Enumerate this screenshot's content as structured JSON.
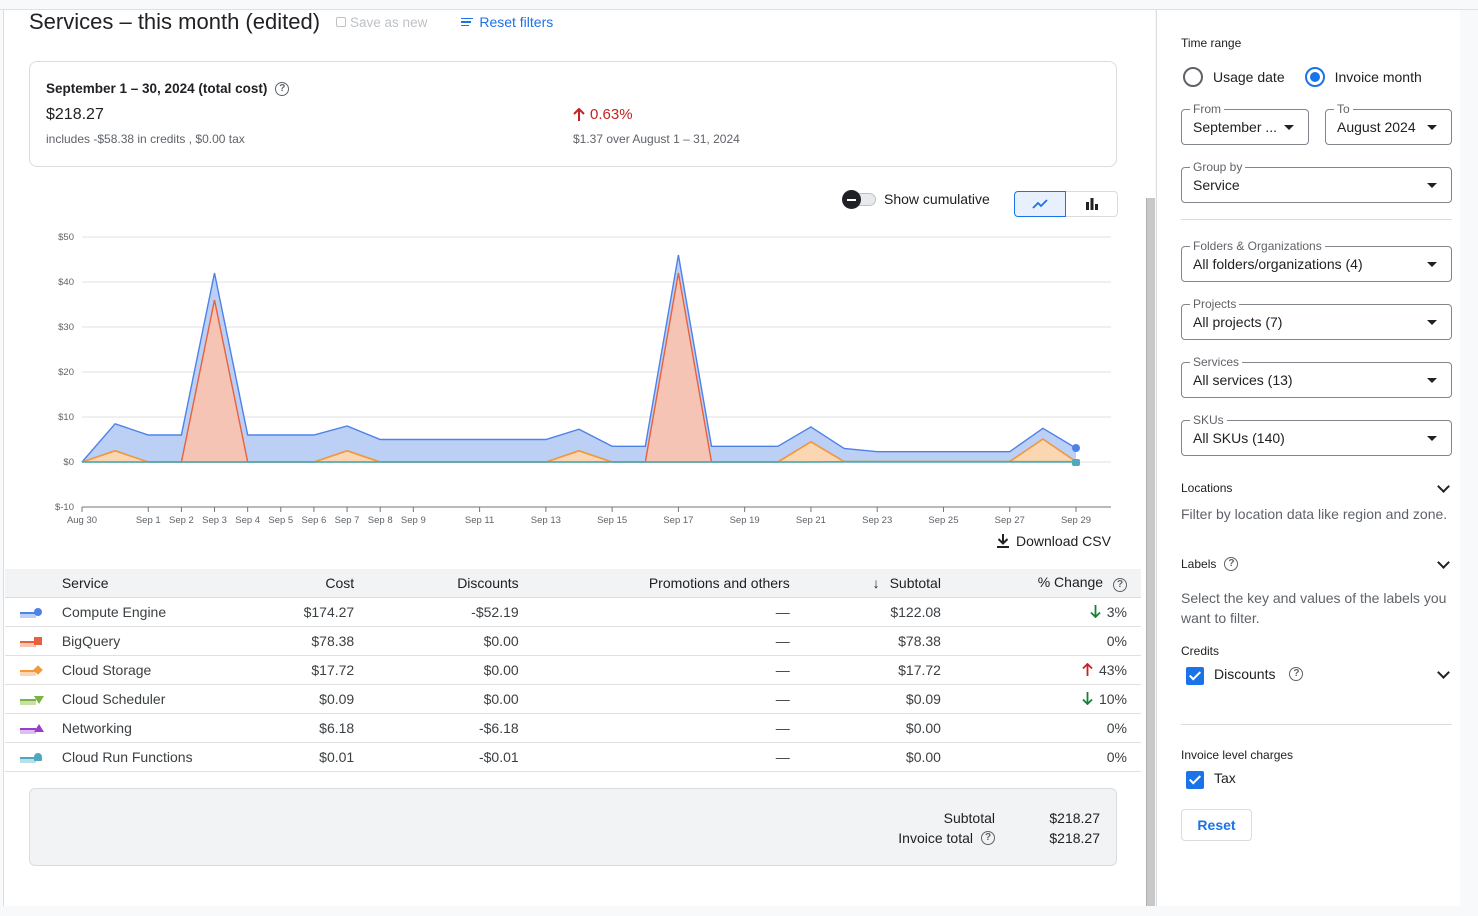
{
  "header": {
    "title": "Services – this month (edited)",
    "save_as_new": "Save as new",
    "reset_filters": "Reset filters"
  },
  "summary": {
    "title": "September 1 – 30, 2024 (total cost)",
    "total": "$218.27",
    "subtext": "includes -$58.38 in credits , $0.00 tax",
    "change": "0.63%",
    "change_direction": "up",
    "change_subtext": "$1.37 over August 1 – 31, 2024"
  },
  "chart_controls": {
    "show_cumulative_label": "Show cumulative",
    "show_cumulative_on": false,
    "selected_chart_type": "line"
  },
  "chart_data": {
    "type": "area",
    "stacked": true,
    "x": [
      "Aug 30",
      "Aug 31",
      "Sep 1",
      "Sep 2",
      "Sep 3",
      "Sep 4",
      "Sep 5",
      "Sep 6",
      "Sep 7",
      "Sep 8",
      "Sep 9",
      "Sep 10",
      "Sep 11",
      "Sep 12",
      "Sep 13",
      "Sep 14",
      "Sep 15",
      "Sep 16",
      "Sep 17",
      "Sep 18",
      "Sep 19",
      "Sep 20",
      "Sep 21",
      "Sep 22",
      "Sep 23",
      "Sep 24",
      "Sep 25",
      "Sep 26",
      "Sep 27",
      "Sep 28",
      "Sep 29"
    ],
    "x_tick_labels": [
      "Aug 30",
      "Sep 1",
      "Sep 2",
      "Sep 3",
      "Sep 4",
      "Sep 5",
      "Sep 6",
      "Sep 7",
      "Sep 8",
      "Sep 9",
      "Sep 11",
      "Sep 13",
      "Sep 15",
      "Sep 17",
      "Sep 19",
      "Sep 21",
      "Sep 23",
      "Sep 25",
      "Sep 27",
      "Sep 29"
    ],
    "y_tick_labels": [
      "$-10",
      "$0",
      "$10",
      "$20",
      "$30",
      "$40",
      "$50"
    ],
    "ylim": [
      -10,
      50
    ],
    "grid": true,
    "series": [
      {
        "name": "Cloud Run Functions",
        "color": "#4fa9be",
        "fill": "#b9e0e8",
        "values": [
          0,
          0,
          0,
          0,
          0,
          0,
          0,
          0,
          0,
          0,
          0,
          0,
          0,
          0,
          0,
          0,
          0,
          0,
          0,
          0,
          0,
          0,
          0,
          0,
          0,
          0,
          0,
          0,
          0,
          0,
          0
        ]
      },
      {
        "name": "Cloud Scheduler",
        "color": "#7cb342",
        "fill": "#c5e1a5",
        "values": [
          0,
          0,
          0,
          0,
          0,
          0,
          0,
          0,
          0,
          0,
          0,
          0,
          0,
          0,
          0,
          0,
          0,
          0,
          0,
          0,
          0,
          0,
          0,
          0.1,
          0.1,
          0.1,
          0.1,
          0.1,
          0.1,
          0.1,
          0.1
        ]
      },
      {
        "name": "Cloud Storage",
        "color": "#f29a38",
        "fill": "#fad6b2",
        "values": [
          0,
          2.5,
          0,
          0,
          0,
          0,
          0,
          0,
          2.5,
          0,
          0,
          0,
          0,
          0,
          0,
          2.5,
          0,
          0,
          0,
          0,
          0,
          0,
          4.5,
          0,
          0,
          0,
          0,
          0,
          0,
          5,
          0
        ]
      },
      {
        "name": "BigQuery",
        "color": "#e8613c",
        "fill": "#f6c4b4",
        "values": [
          0,
          0,
          0,
          0,
          36,
          0,
          0,
          0,
          0,
          0,
          0,
          0,
          0,
          0,
          0,
          0,
          0,
          0,
          42,
          0,
          0,
          0,
          0,
          0,
          0,
          0,
          0,
          0,
          0,
          0,
          0
        ]
      },
      {
        "name": "Compute Engine",
        "color": "#4e82e8",
        "fill": "#bcd0f6",
        "values": [
          0,
          6,
          6,
          6,
          6,
          6,
          6,
          6,
          5.5,
          5,
          5,
          5,
          5,
          5,
          5,
          4.8,
          3.5,
          3.5,
          4,
          3.5,
          3.5,
          3.5,
          3.3,
          2.9,
          2.2,
          2.2,
          2.2,
          2.2,
          2.2,
          2.4,
          3
        ]
      }
    ],
    "title": "",
    "xlabel": "",
    "ylabel": ""
  },
  "download_csv": "Download CSV",
  "table": {
    "columns": [
      "Service",
      "Cost",
      "Discounts",
      "Promotions and others",
      "Subtotal",
      "% Change"
    ],
    "sort_column": "Subtotal",
    "sort_direction": "desc",
    "rows": [
      {
        "service": "Compute Engine",
        "color": "#4e82e8",
        "fill": "#bcd0f6",
        "marker": "circle",
        "cost": "$174.27",
        "discounts": "-$52.19",
        "promotions": "—",
        "subtotal": "$122.08",
        "change": "3%",
        "change_dir": "down"
      },
      {
        "service": "BigQuery",
        "color": "#e8613c",
        "fill": "#f6c4b4",
        "marker": "square",
        "cost": "$78.38",
        "discounts": "$0.00",
        "promotions": "—",
        "subtotal": "$78.38",
        "change": "0%",
        "change_dir": "none"
      },
      {
        "service": "Cloud Storage",
        "color": "#f29a38",
        "fill": "#fad6b2",
        "marker": "diamond",
        "cost": "$17.72",
        "discounts": "$0.00",
        "promotions": "—",
        "subtotal": "$17.72",
        "change": "43%",
        "change_dir": "up"
      },
      {
        "service": "Cloud Scheduler",
        "color": "#7cb342",
        "fill": "#c5e1a5",
        "marker": "triangle-down",
        "cost": "$0.09",
        "discounts": "$0.00",
        "promotions": "—",
        "subtotal": "$0.09",
        "change": "10%",
        "change_dir": "down"
      },
      {
        "service": "Networking",
        "color": "#9c3ccf",
        "fill": "#dcc0ec",
        "marker": "triangle-up",
        "cost": "$6.18",
        "discounts": "-$6.18",
        "promotions": "—",
        "subtotal": "$0.00",
        "change": "0%",
        "change_dir": "none"
      },
      {
        "service": "Cloud Run Functions",
        "color": "#4fa9be",
        "fill": "#b9e0e8",
        "marker": "rounded",
        "cost": "$0.01",
        "discounts": "-$0.01",
        "promotions": "—",
        "subtotal": "$0.00",
        "change": "0%",
        "change_dir": "none"
      }
    ]
  },
  "totals": {
    "subtotal_label": "Subtotal",
    "subtotal_value": "$218.27",
    "invoice_label": "Invoice total",
    "invoice_value": "$218.27"
  },
  "sidebar": {
    "time_range_label": "Time range",
    "usage_date": "Usage date",
    "invoice_month": "Invoice month",
    "selected_time_mode": "invoice_month",
    "from_label": "From",
    "from_value": "September ...",
    "to_label": "To",
    "to_value": "August 2024",
    "group_by_label": "Group by",
    "group_by_value": "Service",
    "folders_label": "Folders & Organizations",
    "folders_value": "All folders/organizations (4)",
    "projects_label": "Projects",
    "projects_value": "All projects (7)",
    "services_label": "Services",
    "services_value": "All services (13)",
    "skus_label": "SKUs",
    "skus_value": "All SKUs (140)",
    "locations_label": "Locations",
    "locations_desc": "Filter by location data like region and zone.",
    "labels_label": "Labels",
    "labels_desc": "Select the key and values of the labels you want to filter.",
    "credits_label": "Credits",
    "discounts_label": "Discounts",
    "discounts_checked": true,
    "invoice_charges_label": "Invoice level charges",
    "tax_label": "Tax",
    "tax_checked": true,
    "reset_label": "Reset"
  }
}
